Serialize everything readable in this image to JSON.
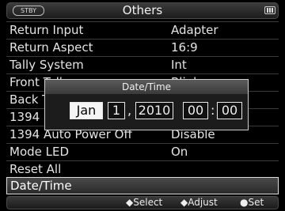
{
  "header": {
    "status": "STBY",
    "title": "Others",
    "battery_icon": "battery-icon"
  },
  "menu": {
    "items": [
      {
        "label": "Return Input",
        "value": "Adapter"
      },
      {
        "label": "Return Aspect",
        "value": "16:9"
      },
      {
        "label": "Tally System",
        "value": "Int"
      },
      {
        "label": "Front Tally",
        "value": "Blink"
      },
      {
        "label": "Back Tally",
        "value": ""
      },
      {
        "label": "1394",
        "value": ""
      },
      {
        "label": "1394 Auto Power Off",
        "value": "Disable"
      },
      {
        "label": "Mode LED",
        "value": "On"
      },
      {
        "label": "Reset All",
        "value": ""
      },
      {
        "label": "Date/Time",
        "value": ""
      }
    ],
    "selected": "Date/Time"
  },
  "dialog": {
    "title": "Date/Time",
    "month": "Jan",
    "day": "1",
    "year": "2010",
    "hour": "00",
    "minute": "00",
    "date_separator": ",",
    "time_separator": ":"
  },
  "footer": {
    "select": "◆Select",
    "adjust": "◆Adjust",
    "set": "●Set"
  },
  "colors": {
    "background": "#000000",
    "bar": "#2c2c2c",
    "active_field": "#f4f4f4"
  }
}
